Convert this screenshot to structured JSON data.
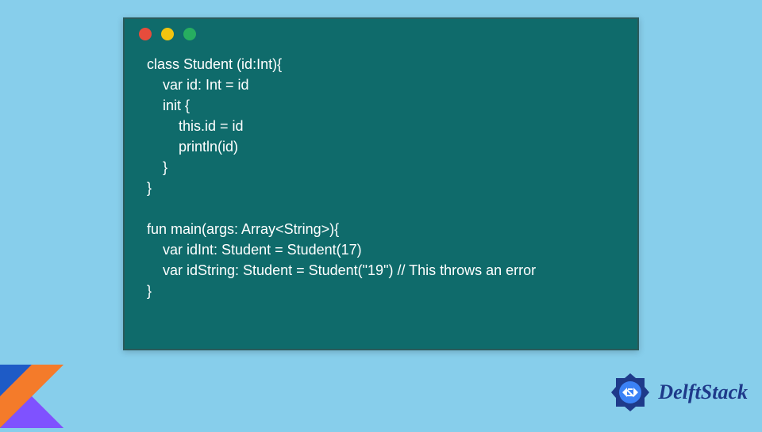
{
  "window": {
    "dots": [
      "red",
      "yellow",
      "green"
    ]
  },
  "code": {
    "lines": [
      "class Student (id:Int){",
      "    var id: Int = id",
      "    init {",
      "        this.id = id",
      "        println(id)",
      "    }",
      "}",
      "",
      "fun main(args: Array<String>){",
      "    var idInt: Student = Student(17)",
      "    var idString: Student = Student(\"19\") // This throws an error",
      "}"
    ]
  },
  "brand": {
    "name": "DelftStack"
  },
  "colors": {
    "page_bg": "#87ceeb",
    "window_bg": "#0f6b6b",
    "code_text": "#ffffff",
    "brand_text": "#1e3a8a"
  }
}
